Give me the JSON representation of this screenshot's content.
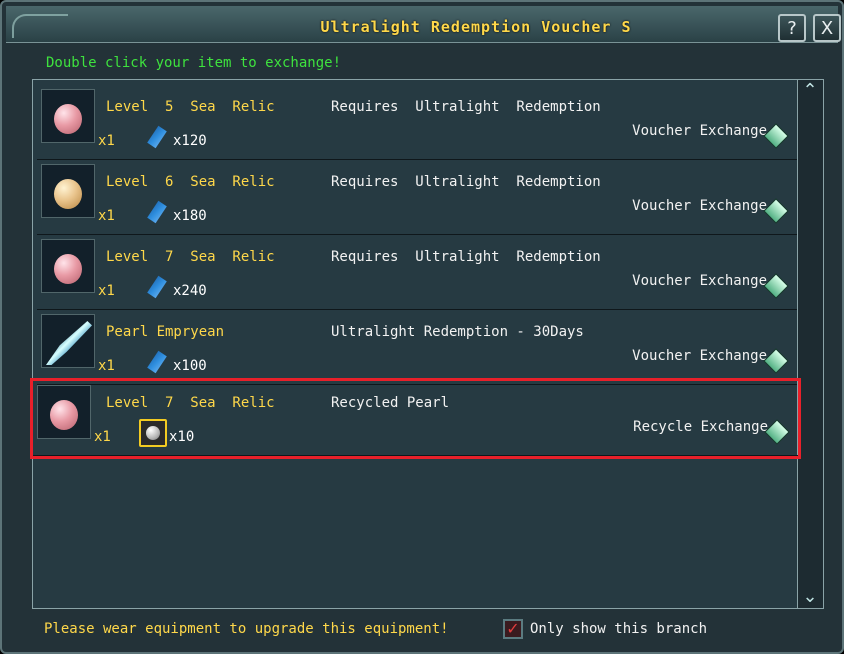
{
  "window": {
    "title": "Ultralight Redemption Voucher S",
    "help_label": "?",
    "close_label": "X"
  },
  "instruction": "Double click your item to exchange!",
  "scrollbar": {
    "up_icon": "chevron-up",
    "down_icon": "chevron-down"
  },
  "rows": [
    {
      "icon": "pink-pearl",
      "quantity": "x1",
      "cost_icon": "voucher-icon",
      "cost_quantity": "x120",
      "title_gold": "Level  5  Sea  Relic",
      "requirement": "Requires  Ultralight  Redemption",
      "exchange_label": "Voucher Exchange"
    },
    {
      "icon": "gold-pearl",
      "quantity": "x1",
      "cost_icon": "voucher-icon",
      "cost_quantity": "x180",
      "title_gold": "Level  6  Sea  Relic",
      "requirement": "Requires  Ultralight  Redemption",
      "exchange_label": "Voucher Exchange"
    },
    {
      "icon": "pink-pearl",
      "quantity": "x1",
      "cost_icon": "voucher-icon",
      "cost_quantity": "x240",
      "title_gold": "Level  7  Sea  Relic",
      "requirement": "Requires  Ultralight  Redemption",
      "exchange_label": "Voucher Exchange"
    },
    {
      "icon": "spear",
      "quantity": "x1",
      "cost_icon": "voucher-icon",
      "cost_quantity": "x100",
      "title_gold": "Pearl Empryean",
      "requirement": "Ultralight Redemption - 30Days",
      "exchange_label": "Voucher Exchange"
    },
    {
      "icon": "pink-pearl",
      "quantity": "x1",
      "cost_icon": "pearl-coin-icon",
      "cost_quantity": "x10",
      "title_gold": "Level  7  Sea  Relic",
      "requirement": "Recycled Pearl",
      "exchange_label": "Recycle Exchange",
      "selected": true
    }
  ],
  "footer": {
    "warning": "Please wear equipment to upgrade this equipment!",
    "checkbox_label": "Only show this branch",
    "checkbox_checked": true
  },
  "colors": {
    "instruction": "#3ee23e",
    "gold_text": "#ffd84a",
    "selection_border": "#e8202a"
  }
}
